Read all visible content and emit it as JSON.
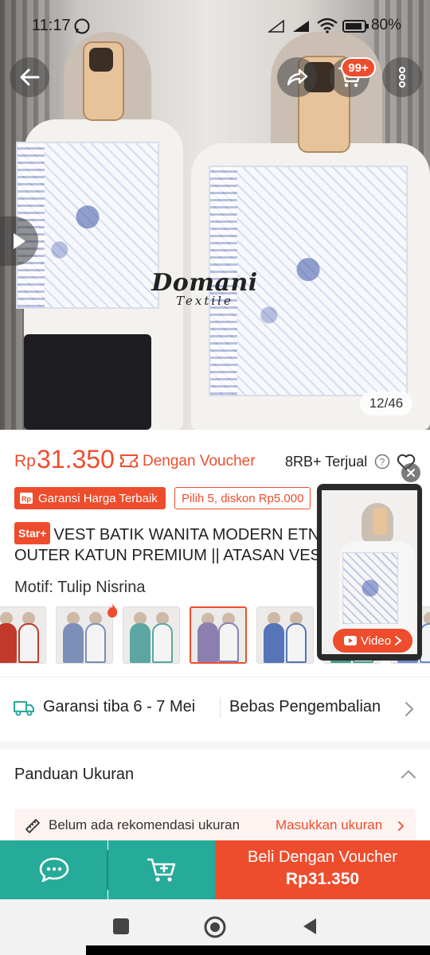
{
  "status_bar": {
    "time": "11:17",
    "battery": "80%"
  },
  "gallery": {
    "watermark_main": "Domani",
    "watermark_sub": "Textile",
    "counter": "12/46",
    "cart_badge": "99+"
  },
  "product": {
    "currency": "Rp",
    "price": "31.350",
    "voucher_label": "Dengan Voucher",
    "sold": "8RB+ Terjual",
    "badge_guarantee": "Garansi Harga Terbaik",
    "badge_discount": "Pilih 5, diskon Rp5.000",
    "star_badge": "Star+",
    "title_line1": "VEST BATIK WANITA MODERN ETNIK",
    "title_line2": "OUTER KATUN PREMIUM || ATASAN VEST",
    "motif_label": "Motif: Tulip Nisrina"
  },
  "thumb_colors": [
    "#c0392b",
    "#7b8fb8",
    "#5ba6a1",
    "#8c7fb0",
    "#5674b8",
    "#3e9d8c",
    "#6b8cc9",
    "#3fa08c"
  ],
  "float_video": {
    "label": "Video"
  },
  "shipping": {
    "arrival": "Garansi tiba 6 - 7 Mei",
    "returns": "Bebas Pengembalian"
  },
  "size_guide": {
    "title": "Panduan Ukuran",
    "reco_text": "Belum ada rekomendasi ukuran",
    "reco_link": "Masukkan ukuran"
  },
  "bottom_bar": {
    "buy_label": "Beli Dengan Voucher",
    "buy_price": "Rp31.350"
  },
  "colors": {
    "accent": "#ee4d2d",
    "teal": "#26aa99"
  }
}
